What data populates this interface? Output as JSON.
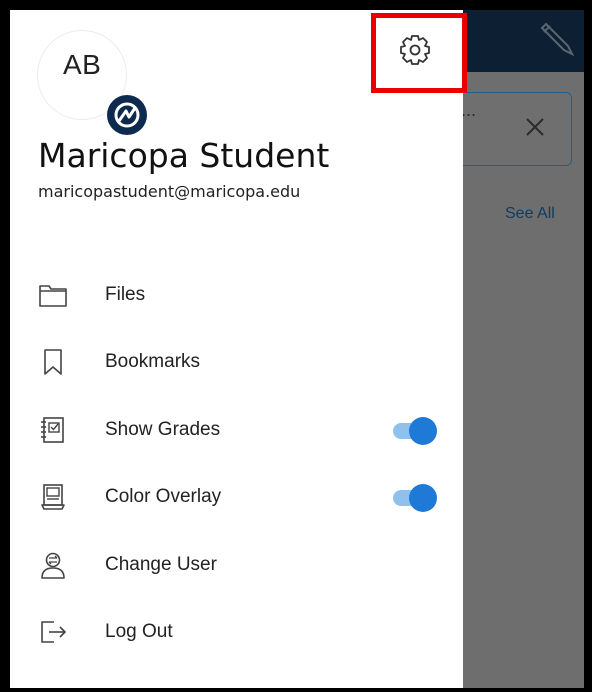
{
  "drawer": {
    "avatar_initials": "AB",
    "user_name": "Maricopa Student",
    "user_email": "maricopastudent@maricopa.edu",
    "menu": [
      {
        "label": "Files",
        "icon": "folder-icon"
      },
      {
        "label": "Bookmarks",
        "icon": "bookmark-icon"
      },
      {
        "label": "Show Grades",
        "icon": "gradebook-icon",
        "toggle": true
      },
      {
        "label": "Color Overlay",
        "icon": "color-overlay-icon",
        "toggle": true
      },
      {
        "label": "Change User",
        "icon": "change-user-icon"
      },
      {
        "label": "Log Out",
        "icon": "logout-icon"
      }
    ]
  },
  "background": {
    "see_all_label": "See All",
    "card_ellipsis": "..."
  },
  "colors": {
    "toggle_on": "#1e7ad6",
    "header_bg": "#0d2033",
    "highlight": "#ea0000"
  }
}
